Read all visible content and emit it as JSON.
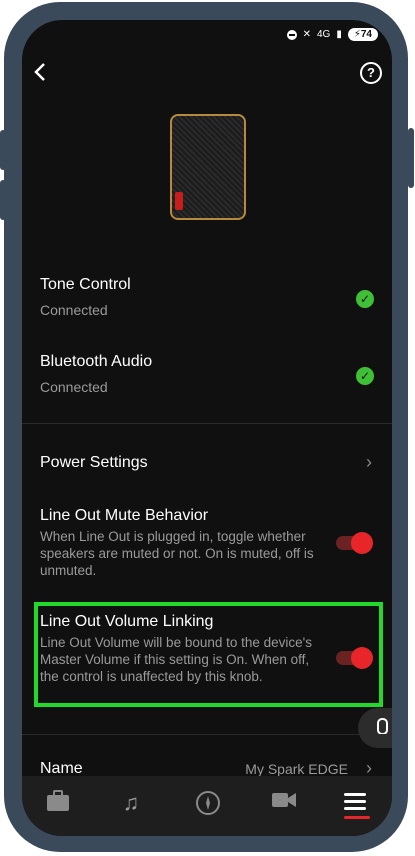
{
  "status_bar": {
    "network": "4G",
    "battery": "74"
  },
  "header": {
    "back_icon": "chevron-left-icon",
    "help_icon": "question-circle-icon"
  },
  "connections": [
    {
      "title": "Tone Control",
      "status": "Connected"
    },
    {
      "title": "Bluetooth Audio",
      "status": "Connected"
    }
  ],
  "settings": {
    "power": {
      "title": "Power Settings"
    },
    "mute": {
      "title": "Line Out Mute Behavior",
      "description": "When Line Out is plugged in, toggle whether speakers are muted or not. On is muted, off is unmuted.",
      "enabled": true
    },
    "volume_linking": {
      "title": "Line Out Volume Linking",
      "description": "Line Out Volume will be bound to the device's Master Volume if this setting is On. When off, the control is unaffected by this knob.",
      "enabled": true
    },
    "name": {
      "title": "Name",
      "value": "My Spark EDGE"
    }
  },
  "colors": {
    "accent": "#e8262a",
    "connected": "#3fbf35",
    "highlight": "#22d82a",
    "frame": "#3b4a5a"
  },
  "nav": [
    {
      "icon": "amp-icon"
    },
    {
      "icon": "music-note-icon"
    },
    {
      "icon": "compass-icon"
    },
    {
      "icon": "video-camera-icon"
    },
    {
      "icon": "menu-icon"
    }
  ]
}
